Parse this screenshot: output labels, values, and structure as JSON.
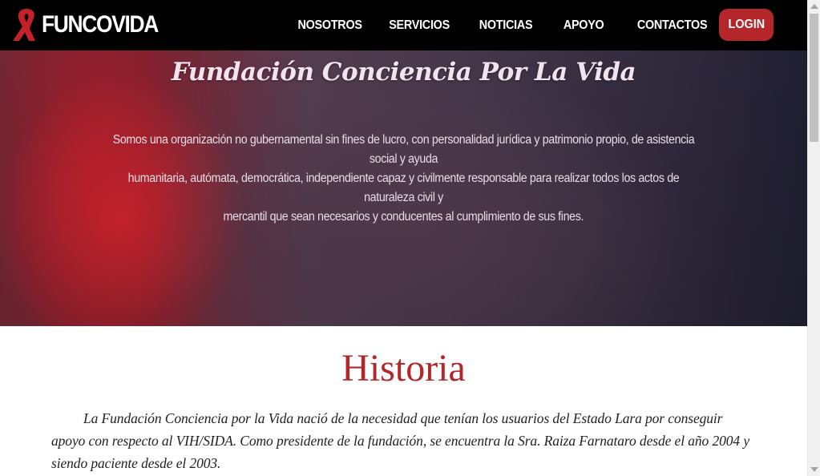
{
  "brand": {
    "logo_text": "FUNCOVIDA",
    "icon": "red-ribbon-icon",
    "accent_color": "#b5262b"
  },
  "nav": {
    "items": [
      {
        "label": "NOSOTROS"
      },
      {
        "label": "SERVICIOS"
      },
      {
        "label": "NOTICIAS"
      },
      {
        "label": "APOYO"
      },
      {
        "label": "CONTACTOS"
      }
    ],
    "login_label": "LOGIN"
  },
  "hero": {
    "title": "Fundación Conciencia Por La Vida",
    "lines": [
      "Somos una organización no gubernamental sin fines de lucro, con personalidad jurídica y patrimonio propio, de asistencia social y ayuda",
      "humanitaria, autómata, democrática, independiente capaz y civilmente responsable para realizar todos los actos de naturaleza civil y",
      "mercantil que sean necesarios y conducentes al cumplimiento de sus fines."
    ]
  },
  "history": {
    "title": "Historia",
    "paragraph": "La Fundación Conciencia por la Vida nació de la necesidad que tenían los usuarios del Estado Lara por conseguir apoyo con respecto al VIH/SIDA. Como presidente de la fundación, se encuentra la Sra. Raiza Farnataro desde el año 2004 y siendo paciente desde el 2003."
  }
}
